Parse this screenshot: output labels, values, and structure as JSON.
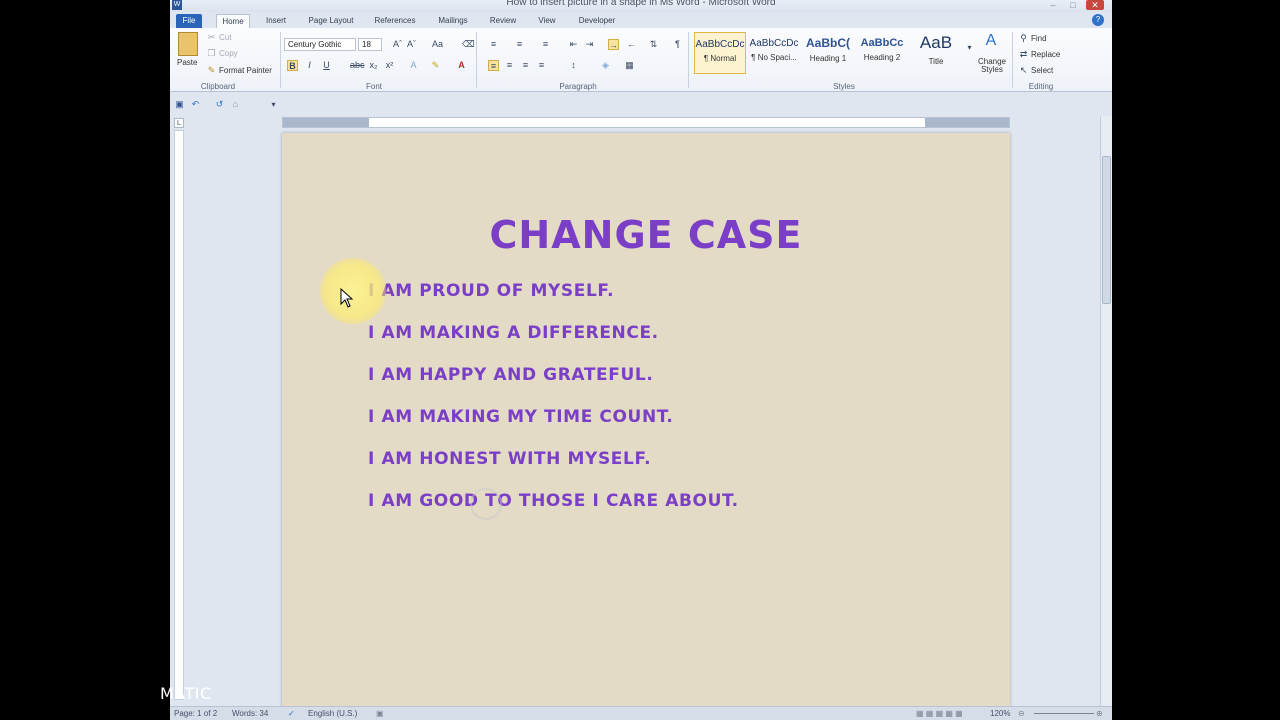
{
  "window": {
    "title": "How to insert picture in a shape in Ms Word - Microsoft Word",
    "app_icon_letter": "W"
  },
  "tabs": [
    "File",
    "Home",
    "Insert",
    "Page Layout",
    "References",
    "Mailings",
    "Review",
    "View",
    "Developer"
  ],
  "ribbon": {
    "clipboard": {
      "paste": "Paste",
      "cut": "Cut",
      "copy": "Copy",
      "format_painter": "Format Painter",
      "label": "Clipboard"
    },
    "font": {
      "family": "Century Gothic",
      "size": "18",
      "label": "Font"
    },
    "paragraph": {
      "label": "Paragraph"
    },
    "styles": {
      "items": [
        {
          "sample": "AaBbCcDc",
          "name": "¶ Normal"
        },
        {
          "sample": "AaBbCcDc",
          "name": "¶ No Spaci..."
        },
        {
          "sample": "AaBbC(",
          "name": "Heading 1"
        },
        {
          "sample": "AaBbCc",
          "name": "Heading 2"
        },
        {
          "sample": "AaB",
          "name": "Title"
        }
      ],
      "change_styles": "Change Styles",
      "label": "Styles"
    },
    "editing": {
      "find": "Find",
      "replace": "Replace",
      "select": "Select",
      "label": "Editing"
    }
  },
  "document": {
    "title": "CHANGE CASE",
    "lines": [
      "I AM PROUD OF MYSELF.",
      "I AM MAKING A DIFFERENCE.",
      "I AM HAPPY AND GRATEFUL.",
      "I AM MAKING MY TIME COUNT.",
      "I AM HONEST WITH MYSELF.",
      "I AM GOOD TO THOSE I CARE ABOUT."
    ]
  },
  "status": {
    "page": "Page: 1 of 2",
    "words": "Words: 34",
    "language": "English (U.S.)",
    "zoom": "120%"
  },
  "watermark": "MATIC",
  "colors": {
    "text_accent": "#7a3fc6",
    "page_bg": "#e3dbc6",
    "file_tab": "#2a64b8"
  }
}
